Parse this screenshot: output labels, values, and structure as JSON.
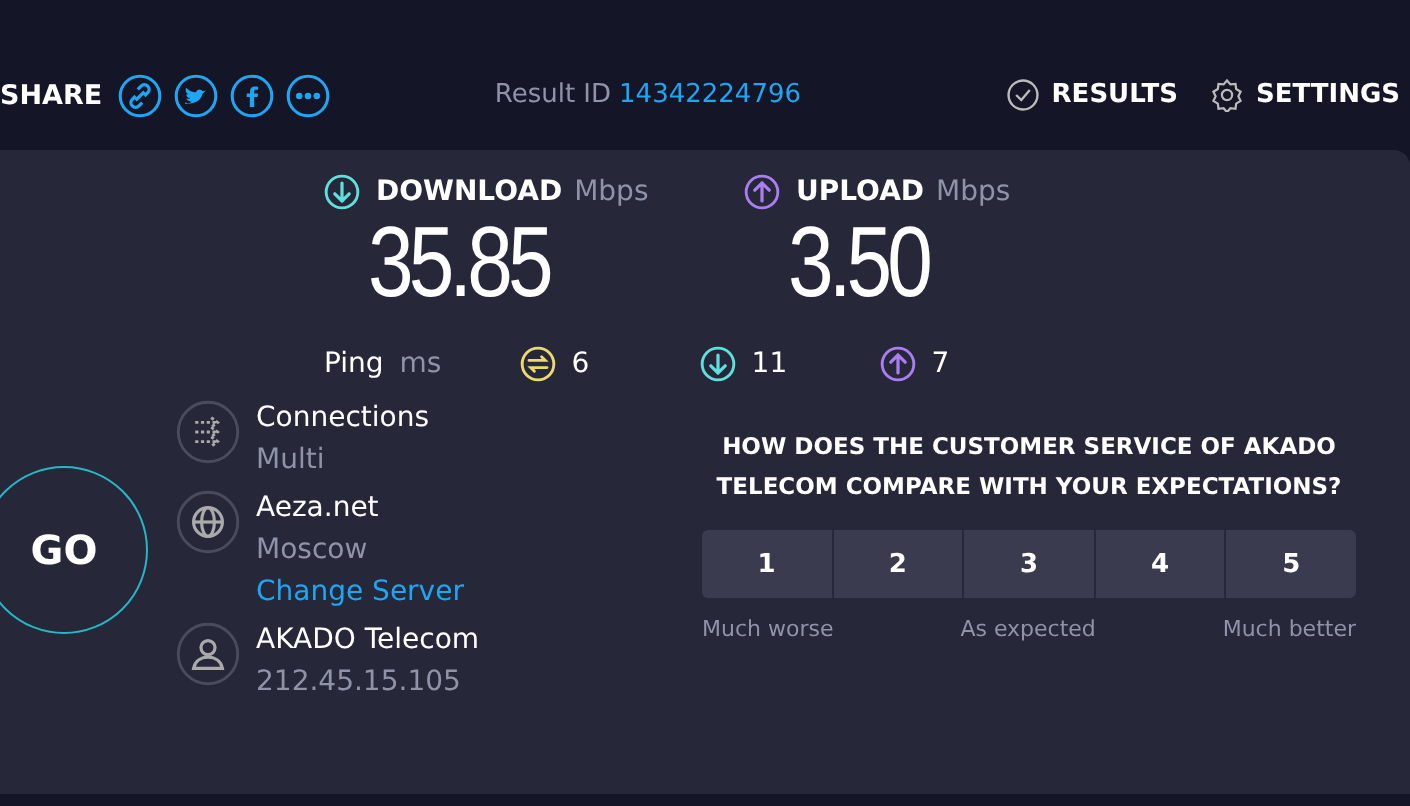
{
  "header": {
    "share_label": "SHARE",
    "share_icons": [
      {
        "kind": "link"
      },
      {
        "kind": "bird"
      },
      {
        "kind": "f"
      },
      {
        "kind": "more"
      }
    ],
    "result_label": "Result ID",
    "result_id": "14342224796",
    "nav": [
      {
        "kind": "results",
        "label": "RESULTS"
      },
      {
        "kind": "settings",
        "label": "SETTINGS"
      }
    ]
  },
  "speeds": [
    {
      "kind": "download",
      "label": "DOWNLOAD",
      "unit": "Mbps",
      "value": "35.85"
    },
    {
      "kind": "upload",
      "label": "UPLOAD",
      "unit": "Mbps",
      "value": "3.50"
    }
  ],
  "ping": {
    "label": "Ping",
    "unit": "ms",
    "readings": [
      {
        "kind": "idle",
        "value": "6"
      },
      {
        "kind": "download",
        "value": "11"
      },
      {
        "kind": "upload",
        "value": "7"
      }
    ]
  },
  "go_button": "GO",
  "info": [
    {
      "kind": "connections",
      "title": "Connections",
      "subtitle": "Multi"
    },
    {
      "kind": "server",
      "title": "Aeza.net",
      "subtitle": "Moscow",
      "link": "Change Server"
    },
    {
      "kind": "provider",
      "title": "AKADO Telecom",
      "subtitle": "212.45.15.105"
    }
  ],
  "survey": {
    "question": "HOW DOES THE CUSTOMER SERVICE OF AKADO TELECOM COMPARE WITH YOUR EXPECTATIONS?",
    "options": [
      "1",
      "2",
      "3",
      "4",
      "5"
    ],
    "scale_labels": [
      "Much worse",
      "As expected",
      "Much better"
    ]
  }
}
